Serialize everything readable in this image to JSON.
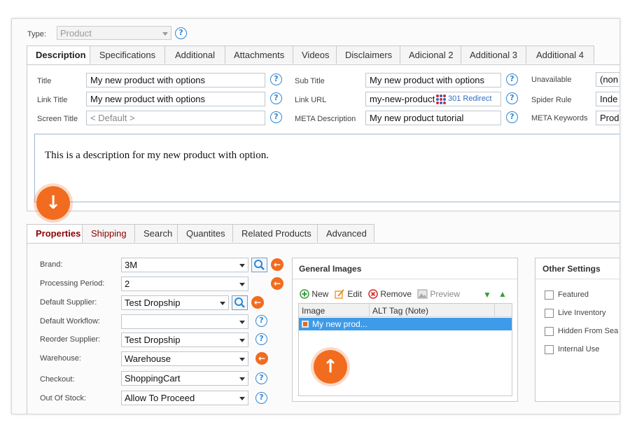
{
  "type": {
    "label": "Type:",
    "value": "Product"
  },
  "top_tabs": [
    "Description",
    "Specifications",
    "Additional",
    "Attachments",
    "Videos",
    "Disclaimers",
    "Adicional 2",
    "Additional 3",
    "Additional 4"
  ],
  "fields": {
    "title": {
      "label": "Title",
      "value": "My new product with options"
    },
    "link_title": {
      "label": "Link Title",
      "value": "My new product with options"
    },
    "screen_title": {
      "label": "Screen Title",
      "placeholder": "< Default >"
    },
    "sub_title": {
      "label": "Sub Title",
      "value": "My new product with options"
    },
    "link_url": {
      "label": "Link URL",
      "value": "my-new-product",
      "redirect": "301 Redirect"
    },
    "meta_description": {
      "label": "META Description",
      "value": "My new product tutorial"
    },
    "unavailable": {
      "label": "Unavailable",
      "value": "(non"
    },
    "spider_rule": {
      "label": "Spider Rule",
      "value": "Inde"
    },
    "meta_keywords": {
      "label": "META Keywords",
      "value": "Prod"
    }
  },
  "description_text": "This is a description for my new product with option.",
  "bottom_tabs": [
    "Properties",
    "Shipping",
    "Search",
    "Quantites",
    "Related Products",
    "Advanced"
  ],
  "properties": [
    {
      "label": "Brand:",
      "value": "3M"
    },
    {
      "label": "Processing Period:",
      "value": "2"
    },
    {
      "label": "Default Supplier:",
      "value": "Test Dropship"
    },
    {
      "label": "Default Workflow:",
      "value": ""
    },
    {
      "label": "Reorder Supplier:",
      "value": "Test Dropship"
    },
    {
      "label": "Warehouse:",
      "value": "Warehouse"
    },
    {
      "label": "Checkout:",
      "value": "ShoppingCart"
    },
    {
      "label": "Out Of Stock:",
      "value": "Allow To Proceed"
    }
  ],
  "images": {
    "title": "General Images",
    "new": "New",
    "edit": "Edit",
    "remove": "Remove",
    "preview": "Preview",
    "col_image": "Image",
    "col_alt": "ALT Tag (Note)",
    "row": "My new prod..."
  },
  "other": {
    "title": "Other Settings",
    "items": [
      "Featured",
      "Live Inventory",
      "Hidden From Sea",
      "Internal Use"
    ]
  },
  "colors": {
    "accent": "#f26c1f",
    "help": "#2f86d4",
    "selected_row": "#3d9be9",
    "tab_red": "#8b0000"
  }
}
